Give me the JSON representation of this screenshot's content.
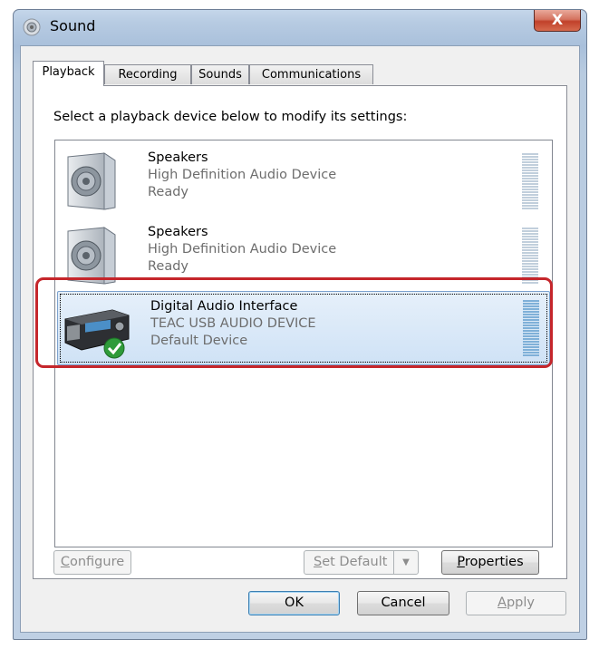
{
  "window": {
    "title": "Sound",
    "close_label": "X"
  },
  "tabs": [
    {
      "label": "Playback"
    },
    {
      "label": "Recording"
    },
    {
      "label": "Sounds"
    },
    {
      "label": "Communications"
    }
  ],
  "instruction": "Select a playback device below to modify its settings:",
  "devices": [
    {
      "name": "Speakers",
      "description": "High Definition Audio Device",
      "status": "Ready"
    },
    {
      "name": "Speakers",
      "description": "High Definition Audio Device",
      "status": "Ready"
    },
    {
      "name": "Digital Audio Interface",
      "description": "TEAC USB AUDIO DEVICE",
      "status": "Default Device"
    }
  ],
  "panel_buttons": {
    "configure": {
      "mnemonic": "C",
      "rest": "onfigure"
    },
    "set_default": {
      "mnemonic": "S",
      "rest": "et Default"
    },
    "properties": {
      "mnemonic": "P",
      "rest": "roperties"
    }
  },
  "dialog_buttons": {
    "ok": "OK",
    "cancel": "Cancel",
    "apply": {
      "mnemonic": "A",
      "rest": "pply"
    }
  },
  "icons": {
    "window_icon": "speaker-icon",
    "speaker_device": "speaker-icon",
    "digital_device": "audio-interface-icon",
    "default_badge": "checkmark-icon",
    "dropdown": "chevron-down-icon"
  }
}
